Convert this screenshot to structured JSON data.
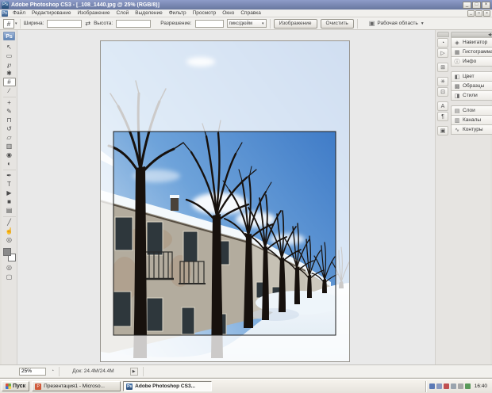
{
  "colors": {
    "titlebar_top": "#8e9cc9",
    "titlebar_bottom": "#68779f",
    "ui_bg": "#f1f0ed",
    "ui_border": "#d6d4cf",
    "canvas_bg": "#e9e9e9",
    "panel_bg": "#e6e4e1",
    "taskbar_bg": "#e6e3dc",
    "sky_deep": "#2b6abf",
    "sky_mid": "#6ea3da",
    "sky_light": "#e8f0f7",
    "snow": "#f7fafd",
    "snow_shadow": "#dce8f2",
    "tree": "#17110d",
    "building": "#b3ac9e",
    "building_far": "#c6c1b5",
    "crop_overlay": "rgba(255,255,255,0.78)",
    "crop_border": "#1e1e1e",
    "fg_swatch": "#8a8a8a",
    "bg_swatch": "#ffffff"
  },
  "title_bar": {
    "icon_text": "Ps",
    "title": "Adobe Photoshop CS3 - [_108_1440.jpg @ 25% (RGB/8)]",
    "minimize_glyph": "_",
    "maximize_glyph": "□",
    "close_glyph": "×"
  },
  "menu_bar": {
    "doc_icon_text": "Ps",
    "items": [
      "Файл",
      "Редактирование",
      "Изображение",
      "Слой",
      "Выделение",
      "Фильтр",
      "Просмотр",
      "Окно",
      "Справка"
    ],
    "doc_minimize_glyph": "_",
    "doc_restore_glyph": "□",
    "doc_close_glyph": "×"
  },
  "options_bar": {
    "tool_glyph": "#",
    "preset_arrow": "▾",
    "width_label": "Ширина:",
    "width_value": "",
    "swap_glyph": "⇄",
    "height_label": "Высота:",
    "height_value": "",
    "resolution_label": "Разрешение:",
    "resolution_value": "",
    "unit_value": "пикс/дюйм",
    "unit_arrow": "▾",
    "image_button": "Изображение",
    "clear_button": "Очистить",
    "workspace_glyph": "▣",
    "workspace_label": "Рабочая область",
    "workspace_arrow": "▼"
  },
  "toolbar": {
    "logo_text": "Ps",
    "tools": [
      {
        "name": "move-tool",
        "glyph": "↖"
      },
      {
        "name": "rectangular-marquee-tool",
        "glyph": "▭"
      },
      {
        "name": "lasso-tool",
        "glyph": "℘"
      },
      {
        "name": "quick-selection-tool",
        "glyph": "✱"
      },
      {
        "name": "crop-tool",
        "glyph": "#",
        "selected": true
      },
      {
        "name": "slice-tool",
        "glyph": "∕"
      },
      {
        "name": "spot-healing-brush-tool",
        "glyph": "+",
        "cls": "sep"
      },
      {
        "name": "brush-tool",
        "glyph": "✎"
      },
      {
        "name": "clone-stamp-tool",
        "glyph": "⊓"
      },
      {
        "name": "history-brush-tool",
        "glyph": "↺"
      },
      {
        "name": "eraser-tool",
        "glyph": "▱"
      },
      {
        "name": "gradient-tool",
        "glyph": "▥"
      },
      {
        "name": "blur-tool",
        "glyph": "◉"
      },
      {
        "name": "dodge-tool",
        "glyph": "◐"
      },
      {
        "name": "pen-tool",
        "glyph": "✒",
        "cls": "sep"
      },
      {
        "name": "type-tool",
        "glyph": "T"
      },
      {
        "name": "path-selection-tool",
        "glyph": "▶"
      },
      {
        "name": "rectangle-tool",
        "glyph": "■"
      },
      {
        "name": "notes-tool",
        "glyph": "▤"
      },
      {
        "name": "eyedropper-tool",
        "glyph": "╱",
        "cls": "sep"
      },
      {
        "name": "hand-tool",
        "glyph": "☝"
      },
      {
        "name": "zoom-tool",
        "glyph": "◎"
      }
    ],
    "quick_mask_glyph": "◎",
    "screen_mode_glyph": "▢"
  },
  "dock": {
    "collapse_arrows": "◀◀",
    "icon_strip": [
      {
        "name": "history-panel-icon",
        "glyph": "◔"
      },
      {
        "name": "actions-panel-icon",
        "glyph": "▷"
      },
      {
        "name": "tool-presets-panel-icon",
        "glyph": "⊞",
        "cls": "gap"
      },
      {
        "name": "brushes-panel-icon",
        "glyph": "✳",
        "cls": "gap"
      },
      {
        "name": "clone-source-panel-icon",
        "glyph": "⊡"
      },
      {
        "name": "character-panel-icon",
        "glyph": "A",
        "cls": "gap"
      },
      {
        "name": "paragraph-panel-icon",
        "glyph": "¶"
      },
      {
        "name": "layer-comps-panel-icon",
        "glyph": "▣",
        "cls": "gap"
      }
    ],
    "panels": [
      {
        "name": "panel-navigator",
        "glyph": "◈",
        "label": "Навигатор"
      },
      {
        "name": "panel-histogram",
        "glyph": "▦",
        "label": "Гистограмма"
      },
      {
        "name": "panel-info",
        "glyph": "ⓘ",
        "label": "Инфо"
      },
      {
        "name": "panel-color",
        "glyph": "◧",
        "label": "Цвет",
        "cls": "gap"
      },
      {
        "name": "panel-swatches",
        "glyph": "▩",
        "label": "Образцы"
      },
      {
        "name": "panel-styles",
        "glyph": "◨",
        "label": "Стили"
      },
      {
        "name": "panel-layers",
        "glyph": "▤",
        "label": "Слои",
        "cls": "gap"
      },
      {
        "name": "panel-channels",
        "glyph": "▥",
        "label": "Каналы"
      },
      {
        "name": "panel-paths",
        "glyph": "∿",
        "label": "Контуры"
      }
    ]
  },
  "status_bar": {
    "zoom_value": "25%",
    "status_icon_glyph": "◔",
    "doc_label": "Док: 24.4M/24.4M",
    "menu_arrow": "▶"
  },
  "taskbar": {
    "start_label": "Пуск",
    "tasks": [
      {
        "name": "task-powerpoint",
        "icon": "P",
        "cls": "ppt",
        "label": "Презентация1 - Microso...",
        "active": false
      },
      {
        "name": "task-photoshop",
        "icon": "Ps",
        "cls": "ps",
        "label": "Adobe Photoshop CS3...",
        "active": true
      }
    ],
    "tray_icons": [
      {
        "name": "tray-icon-1",
        "style": "background:#5b79b5"
      },
      {
        "name": "tray-icon-2",
        "style": "background:#8a9ac0"
      },
      {
        "name": "tray-icon-3",
        "style": "background:#c05050"
      },
      {
        "name": "tray-icon-4",
        "style": "background:#9aa4ae"
      },
      {
        "name": "tray-icon-5",
        "style": "background:#a8a8a8"
      },
      {
        "name": "tray-icon-6",
        "style": "background:#5a9a5a"
      }
    ],
    "clock": "16:40"
  }
}
